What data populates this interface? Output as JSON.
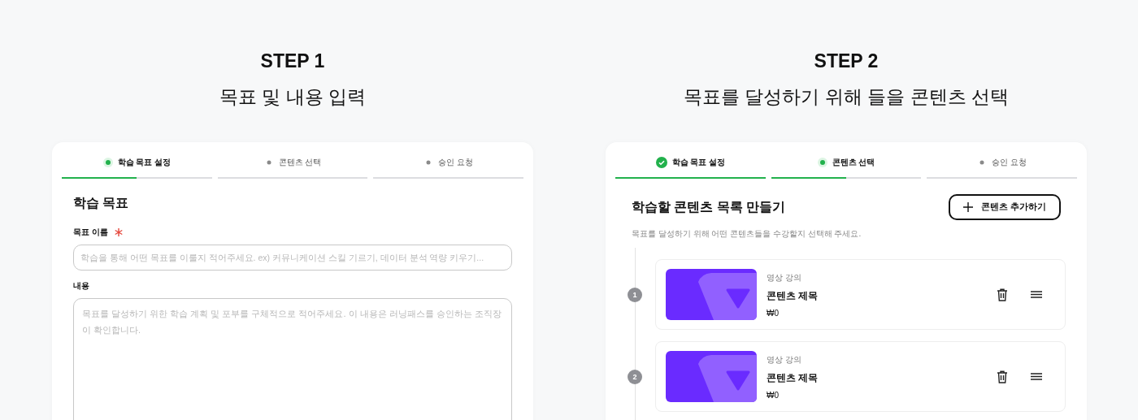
{
  "panels": [
    {
      "step_label": "STEP 1",
      "step_title": "목표 및 내용 입력",
      "steps": [
        {
          "label": "학습 목표 설정",
          "kind": "current",
          "level": 0.5
        },
        {
          "label": "콘텐츠 선택",
          "kind": "pending",
          "level": 0
        },
        {
          "label": "승인 요청",
          "kind": "pending",
          "level": 0
        }
      ],
      "kind": "form",
      "section_title": "학습 목표",
      "fields": [
        {
          "label": "목표 이름",
          "required": true,
          "kind": "input",
          "placeholder": "학습을 통해 어떤 목표를 이룰지 적어주세요. ex) 커뮤니케이션 스킬 기르기, 데이터 분석 역량 키우기..."
        },
        {
          "label": "내용",
          "required": false,
          "kind": "textarea",
          "placeholder": "목표를 달성하기 위한 학습 계획 및 포부를 구체적으로 적어주세요. 이 내용은 러닝패스를 승인하는 조직장이 확인합니다."
        }
      ]
    },
    {
      "step_label": "STEP 2",
      "step_title": "목표를 달성하기 위해 들을 콘텐츠 선택",
      "steps": [
        {
          "label": "학습 목표 설정",
          "kind": "done",
          "level": 1
        },
        {
          "label": "콘텐츠 선택",
          "kind": "current",
          "level": 0.5
        },
        {
          "label": "승인 요청",
          "kind": "pending",
          "level": 0
        }
      ],
      "kind": "list",
      "section_title": "학습할 콘텐츠 목록 만들기",
      "add_button": "콘텐츠 추가하기",
      "description": "목표를 달성하기 위해 어떤 콘텐츠들을 수강할지 선택해 주세요.",
      "items": [
        {
          "number": "1",
          "type": "영상 강의",
          "title": "콘텐츠 제목",
          "price": "₩0"
        },
        {
          "number": "2",
          "type": "영상 강의",
          "title": "콘텐츠 제목",
          "price": "₩0"
        }
      ]
    }
  ]
}
